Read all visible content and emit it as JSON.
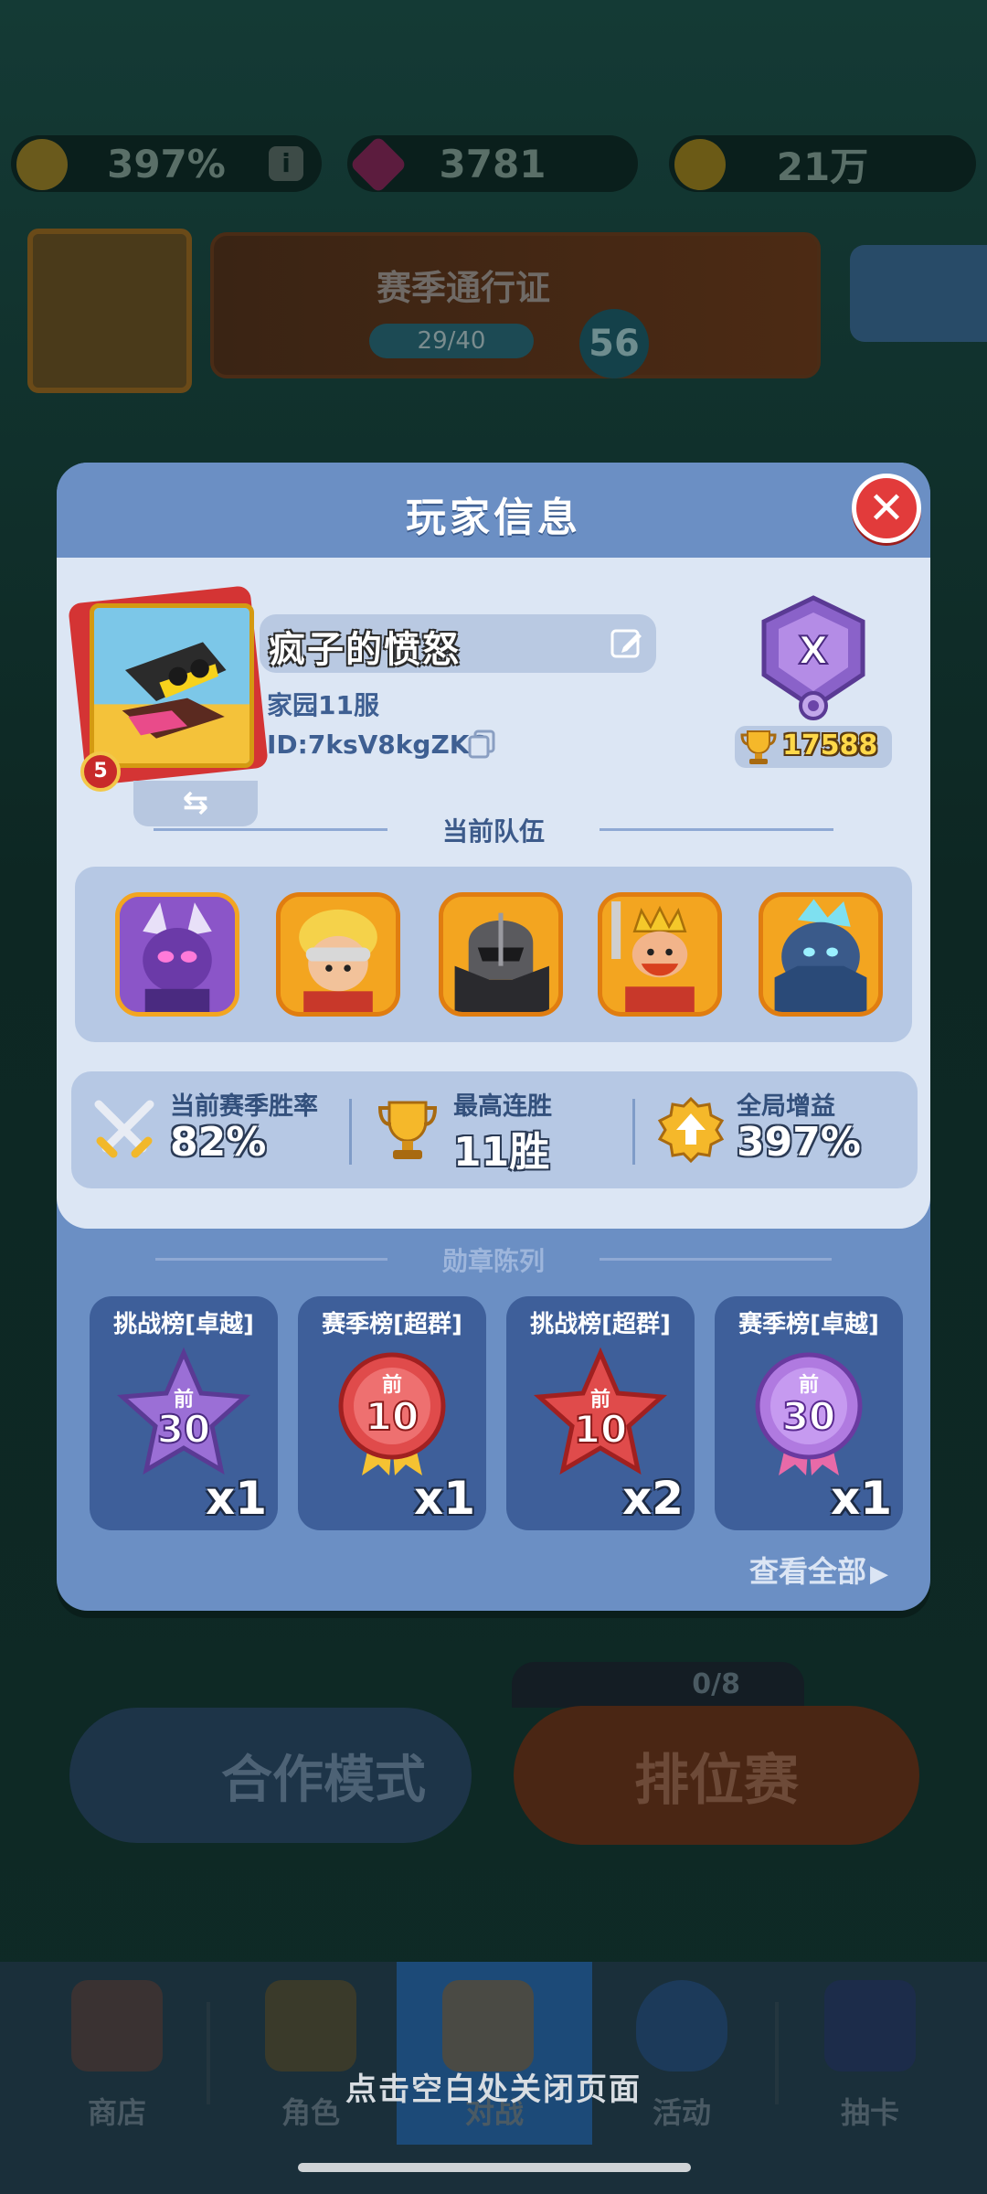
{
  "background": {
    "resources": {
      "boost": "397%",
      "gems": "3781",
      "coins": "21万"
    },
    "season_pass": {
      "title": "赛季通行证",
      "progress": "29/40",
      "level": "56"
    },
    "coop_mode": "合作模式",
    "ranked_mode": "排位赛",
    "ranked_progress": "0/8"
  },
  "modal": {
    "title": "玩家信息",
    "close_icon": "close-icon",
    "player": {
      "level": "5",
      "name": "疯子的愤怒",
      "server": "家园11服",
      "id": "ID:7ksV8kgZK6",
      "rank_letter": "X",
      "trophies": "17588"
    },
    "team": {
      "title": "当前队伍",
      "heroes": [
        "purple-horned-hero",
        "blonde-goggles-hero",
        "dark-armored-hero",
        "crowned-king-hero",
        "ice-golem-hero"
      ]
    },
    "stats": [
      {
        "label": "当前赛季胜率",
        "value": "82%",
        "icon": "crossed-swords-icon"
      },
      {
        "label": "最高连胜",
        "value": "11胜",
        "icon": "trophy-icon"
      },
      {
        "label": "全局增益",
        "value": "397%",
        "icon": "boost-badge-icon"
      }
    ],
    "medals": {
      "title": "勋章陈列",
      "items": [
        {
          "name": "挑战榜[卓越]",
          "prefix": "前",
          "rank": "30",
          "count": "x1",
          "color": "#9b6fd6"
        },
        {
          "name": "赛季榜[超群]",
          "prefix": "前",
          "rank": "10",
          "count": "x1",
          "color": "#e04b4b"
        },
        {
          "name": "挑战榜[超群]",
          "prefix": "前",
          "rank": "10",
          "count": "x2",
          "color": "#e04b4b"
        },
        {
          "name": "赛季榜[卓越]",
          "prefix": "前",
          "rank": "30",
          "count": "x1",
          "color": "#b07ae0"
        }
      ],
      "view_all": "查看全部"
    }
  },
  "bottom_nav": {
    "items": [
      "商店",
      "角色",
      "对战",
      "活动",
      "抽卡"
    ]
  },
  "close_hint": "点击空白处关闭页面"
}
